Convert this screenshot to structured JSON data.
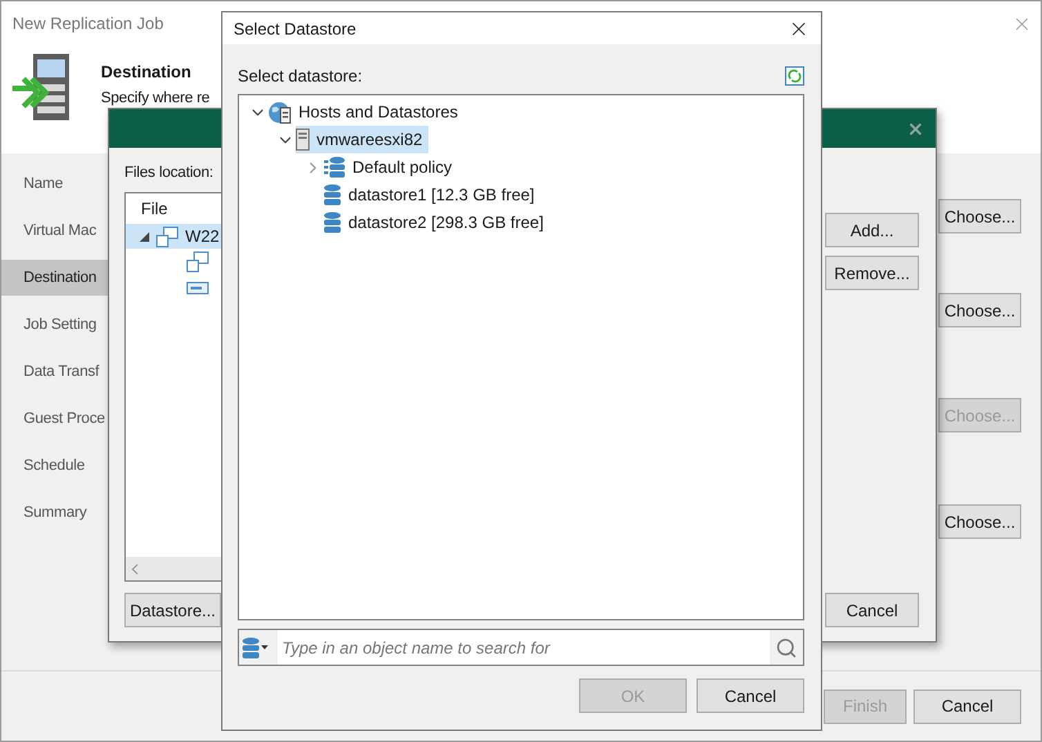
{
  "main_window": {
    "title": "New Replication Job",
    "header": {
      "title": "Destination",
      "subtitle": "Specify where re"
    },
    "steps": [
      {
        "label": "Name",
        "selected": false
      },
      {
        "label": "Virtual Mac",
        "selected": false
      },
      {
        "label": "Destination",
        "selected": true
      },
      {
        "label": "Job Setting",
        "selected": false
      },
      {
        "label": "Data Transf",
        "selected": false
      },
      {
        "label": "Guest Proce",
        "selected": false
      },
      {
        "label": "Schedule",
        "selected": false
      },
      {
        "label": "Summary",
        "selected": false
      }
    ],
    "choose_buttons": [
      {
        "label": "Choose...",
        "disabled": false
      },
      {
        "label": "Choose...",
        "disabled": false
      },
      {
        "label": "Choose...",
        "disabled": true
      },
      {
        "label": "Choose...",
        "disabled": false
      }
    ],
    "footer_buttons": [
      {
        "label": "Finish",
        "disabled": true
      },
      {
        "label": "Cancel",
        "disabled": false
      }
    ]
  },
  "files_dialog": {
    "label": "Files location:",
    "column": "File",
    "rows": [
      {
        "label": "W22",
        "selected": true,
        "expanded": true,
        "children": [
          {
            "kind": "vm"
          },
          {
            "kind": "disk"
          }
        ]
      }
    ],
    "left_button": "Datastore...",
    "right_buttons": [
      "Add...",
      "Remove..."
    ],
    "cancel_button": "Cancel"
  },
  "select_dialog": {
    "title": "Select Datastore",
    "label": "Select datastore:",
    "tree": [
      {
        "label": "Hosts and Datastores",
        "kind": "root",
        "expanded": true,
        "selected": false,
        "children": [
          {
            "label": "vmwareesxi82",
            "kind": "host",
            "expanded": true,
            "selected": true,
            "children": [
              {
                "label": "Default policy",
                "kind": "policy",
                "expanded": false,
                "selected": false
              },
              {
                "label": "datastore1 [12.3 GB free]",
                "kind": "datastore",
                "selected": false
              },
              {
                "label": "datastore2 [298.3 GB free]",
                "kind": "datastore",
                "selected": false
              }
            ]
          }
        ]
      }
    ],
    "search": {
      "placeholder": "Type in an object name to search for"
    },
    "buttons": [
      {
        "label": "OK",
        "disabled": true
      },
      {
        "label": "Cancel",
        "disabled": false
      }
    ]
  }
}
